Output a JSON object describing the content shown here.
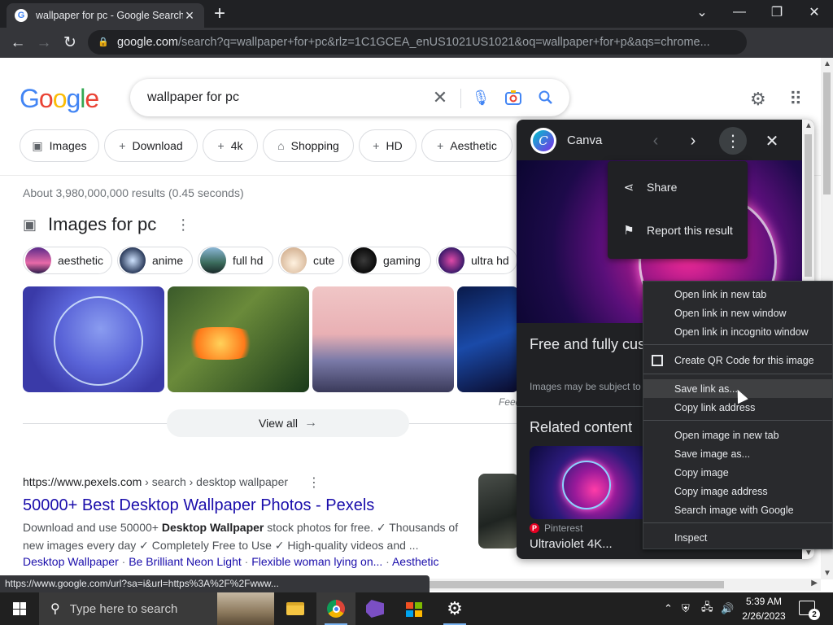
{
  "browser": {
    "tab_title": "wallpaper for pc - Google Search",
    "url_host": "google.com",
    "url_path": "/search?q=wallpaper+for+pc&rlz=1C1GCEA_enUS1021US1021&oq=wallpaper+for+p&aqs=chrome...",
    "status_url": "https://www.google.com/url?sa=i&url=https%3A%2F%2Fwww..."
  },
  "search": {
    "query": "wallpaper for pc",
    "chips": [
      "Images",
      "Download",
      "4k",
      "Shopping",
      "HD",
      "Aesthetic"
    ],
    "results_count": "About 3,980,000,000 results (0.45 seconds)",
    "images_heading": "Images for pc",
    "image_pills": [
      "aesthetic",
      "anime",
      "full hd",
      "cute",
      "gaming",
      "ultra hd"
    ],
    "feedback": "Feed",
    "view_all": "View all"
  },
  "result": {
    "cite_host": "https://www.pexels.com",
    "cite_path": " › search › desktop wallpaper",
    "title": "50000+ Best Desktop Wallpaper Photos - Pexels",
    "snippet_pre": "Download and use 50000+ ",
    "snippet_bold": "Desktop Wallpaper",
    "snippet_post": " stock photos for free. ✓ Thousands of new images every day ✓ Completely Free to Use ✓ High-quality videos and ...",
    "sitelinks": [
      "Desktop Wallpaper",
      "Be Brilliant Neon Light",
      "Flexible woman lying on...",
      "Aesthetic"
    ]
  },
  "panel": {
    "source_name": "Canva",
    "title": "Free and fully customizable desktop wallpaper",
    "subtitle": "Images may be subject to copyright.",
    "related_heading": "Related content",
    "related_source": "Pinterest",
    "related_title": "Ultraviolet 4K...",
    "menu": [
      "Share",
      "Report this result"
    ]
  },
  "context_menu": {
    "items": [
      "Open link in new tab",
      "Open link in new window",
      "Open link in incognito window",
      "Create QR Code for this image",
      "Save link as...",
      "Copy link address",
      "Open image in new tab",
      "Save image as...",
      "Copy image",
      "Copy image address",
      "Search image with Google",
      "Inspect"
    ]
  },
  "taskbar": {
    "search_placeholder": "Type here to search",
    "time": "5:39 AM",
    "date": "2/26/2023",
    "notification_count": "2"
  },
  "colors": {
    "link_blue": "#1a0dab",
    "chrome_dark": "#202124",
    "google_blue": "#4285f4",
    "google_red": "#ea4335",
    "google_yellow": "#fbbc05",
    "google_green": "#34a853"
  }
}
